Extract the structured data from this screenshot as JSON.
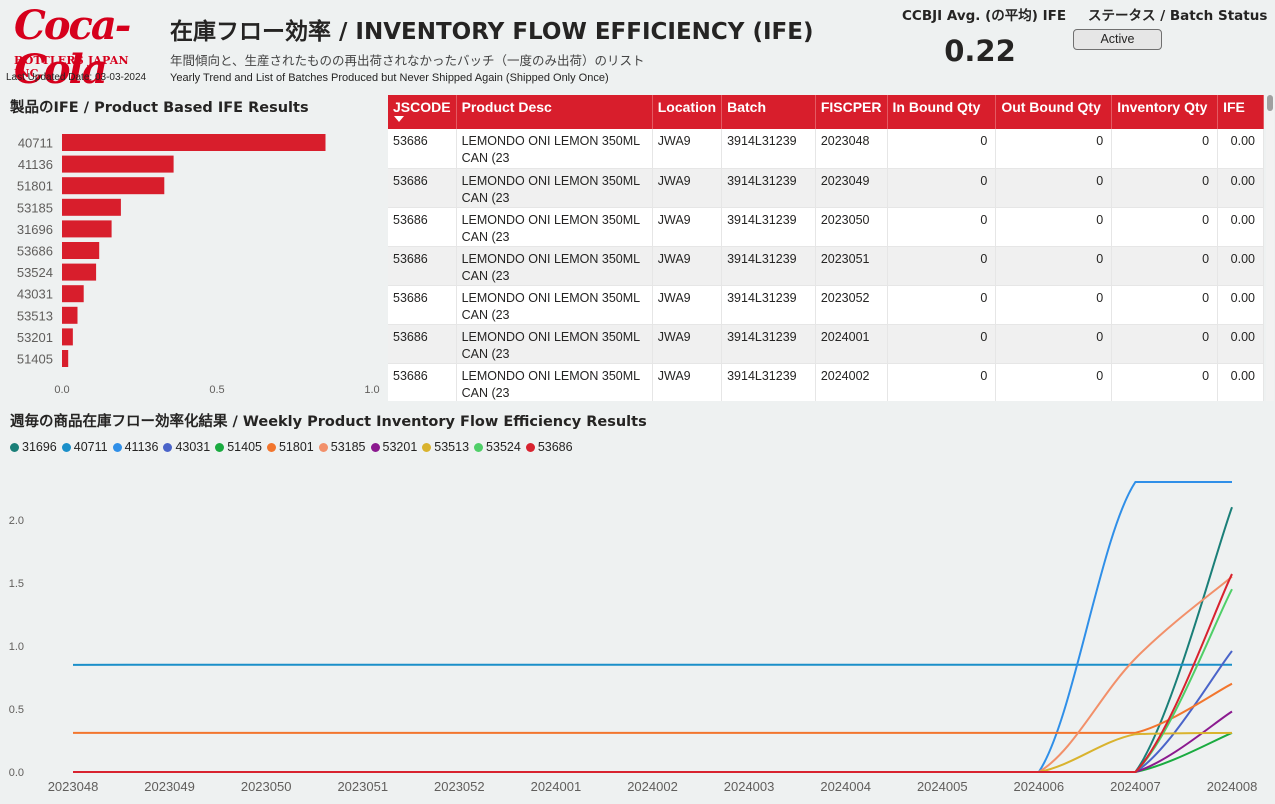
{
  "header": {
    "logo_text": "Coca-Cola",
    "logo_sub": "BOTTLERS JAPAN INC.",
    "last_updated": "Last Updated Date: 03-03-2024",
    "title": "在庫フロー効率 / INVENTORY FLOW EFFICIENCY (IFE)",
    "subtitle_jp": "年間傾向と、生産されたものの再出荷されなかったバッチ（一度のみ出荷）のリスト",
    "subtitle_en": "Yearly Trend and List of Batches Produced but Never Shipped Again (Shipped Only Once)",
    "avg_label": "CCBJI Avg. (の平均) IFE",
    "avg_value": "0.22",
    "status_label": "ステータス / Batch Status",
    "status_value": "Active"
  },
  "bar_chart": {
    "title": "製品のIFE / Product Based IFE Results"
  },
  "table": {
    "columns": [
      "JSCODE",
      "Product Desc",
      "Location",
      "Batch",
      "FISCPER",
      "In Bound Qty",
      "Out Bound Qty",
      "Inventory Qty",
      "IFE"
    ],
    "rows": [
      [
        "53686",
        "LEMONDO ONI LEMON 350ML CAN (23",
        "JWA9",
        "3914L31239",
        "2023048",
        "0",
        "0",
        "0",
        "0.00"
      ],
      [
        "53686",
        "LEMONDO ONI LEMON 350ML CAN (23",
        "JWA9",
        "3914L31239",
        "2023049",
        "0",
        "0",
        "0",
        "0.00"
      ],
      [
        "53686",
        "LEMONDO ONI LEMON 350ML CAN (23",
        "JWA9",
        "3914L31239",
        "2023050",
        "0",
        "0",
        "0",
        "0.00"
      ],
      [
        "53686",
        "LEMONDO ONI LEMON 350ML CAN (23",
        "JWA9",
        "3914L31239",
        "2023051",
        "0",
        "0",
        "0",
        "0.00"
      ],
      [
        "53686",
        "LEMONDO ONI LEMON 350ML CAN (23",
        "JWA9",
        "3914L31239",
        "2023052",
        "0",
        "0",
        "0",
        "0.00"
      ],
      [
        "53686",
        "LEMONDO ONI LEMON 350ML CAN (23",
        "JWA9",
        "3914L31239",
        "2024001",
        "0",
        "0",
        "0",
        "0.00"
      ],
      [
        "53686",
        "LEMONDO ONI LEMON 350ML CAN (23",
        "JWA9",
        "3914L31239",
        "2024002",
        "0",
        "0",
        "0",
        "0.00"
      ]
    ]
  },
  "line_chart": {
    "title": "週毎の商品在庫フロー効率化結果 / Weekly Product Inventory Flow Efficiency Results"
  },
  "chart_data": [
    {
      "type": "bar",
      "orientation": "horizontal",
      "title": "製品のIFE / Product Based IFE Results",
      "categories": [
        "40711",
        "41136",
        "51801",
        "53185",
        "31696",
        "53686",
        "53524",
        "43031",
        "53513",
        "53201",
        "51405"
      ],
      "values": [
        0.85,
        0.36,
        0.33,
        0.19,
        0.16,
        0.12,
        0.11,
        0.07,
        0.05,
        0.035,
        0.02
      ],
      "xlim": [
        0,
        1.0
      ],
      "xticks": [
        "0.0",
        "0.5",
        "1.0"
      ],
      "color": "#d81e2c",
      "grid": false
    },
    {
      "type": "line",
      "title": "週毎の商品在庫フロー効率化結果 / Weekly Product Inventory Flow Efficiency Results",
      "x": [
        "2023048",
        "2023049",
        "2023050",
        "2023051",
        "2023052",
        "2024001",
        "2024002",
        "2024003",
        "2024004",
        "2024005",
        "2024006",
        "2024007",
        "2024008"
      ],
      "ylim": [
        0,
        2.3
      ],
      "yticks": [
        "0.0",
        "0.5",
        "1.0",
        "1.5",
        "2.0"
      ],
      "legend_position": "top-left",
      "grid": false,
      "series": [
        {
          "name": "31696",
          "color": "#1a7f78",
          "values": [
            0,
            0,
            0,
            0,
            0,
            0,
            0,
            0,
            0,
            0,
            0,
            0,
            2.1
          ]
        },
        {
          "name": "40711",
          "color": "#1a8fc9",
          "values": [
            0.85,
            0.85,
            0.85,
            0.85,
            0.85,
            0.85,
            0.85,
            0.85,
            0.85,
            0.85,
            0.85,
            0.85,
            0.85
          ]
        },
        {
          "name": "41136",
          "color": "#2f8fe8",
          "values": [
            0,
            0,
            0,
            0,
            0,
            0,
            0,
            0,
            0,
            0,
            0,
            2.3,
            2.3
          ]
        },
        {
          "name": "43031",
          "color": "#4a64c9",
          "values": [
            0,
            0,
            0,
            0,
            0,
            0,
            0,
            0,
            0,
            0,
            0,
            0,
            0.96
          ]
        },
        {
          "name": "51405",
          "color": "#1aab40",
          "values": [
            0,
            0,
            0,
            0,
            0,
            0,
            0,
            0,
            0,
            0,
            0,
            0,
            0.31
          ]
        },
        {
          "name": "51801",
          "color": "#f2762e",
          "values": [
            0.31,
            0.31,
            0.31,
            0.31,
            0.31,
            0.31,
            0.31,
            0.31,
            0.31,
            0.31,
            0.31,
            0.31,
            0.7
          ]
        },
        {
          "name": "53185",
          "color": "#f2906a",
          "values": [
            0,
            0,
            0,
            0,
            0,
            0,
            0,
            0,
            0,
            0,
            0,
            0.9,
            1.55
          ]
        },
        {
          "name": "53201",
          "color": "#8b1a8f",
          "values": [
            0,
            0,
            0,
            0,
            0,
            0,
            0,
            0,
            0,
            0,
            0,
            0,
            0.48
          ]
        },
        {
          "name": "53513",
          "color": "#d9b32e",
          "values": [
            0,
            0,
            0,
            0,
            0,
            0,
            0,
            0,
            0,
            0,
            0,
            0.3,
            0.31
          ]
        },
        {
          "name": "53524",
          "color": "#4fcf68",
          "values": [
            0,
            0,
            0,
            0,
            0,
            0,
            0,
            0,
            0,
            0,
            0,
            0,
            1.45
          ]
        },
        {
          "name": "53686",
          "color": "#d8232f",
          "values": [
            0,
            0,
            0,
            0,
            0,
            0,
            0,
            0,
            0,
            0,
            0,
            0,
            1.57
          ]
        }
      ]
    }
  ]
}
